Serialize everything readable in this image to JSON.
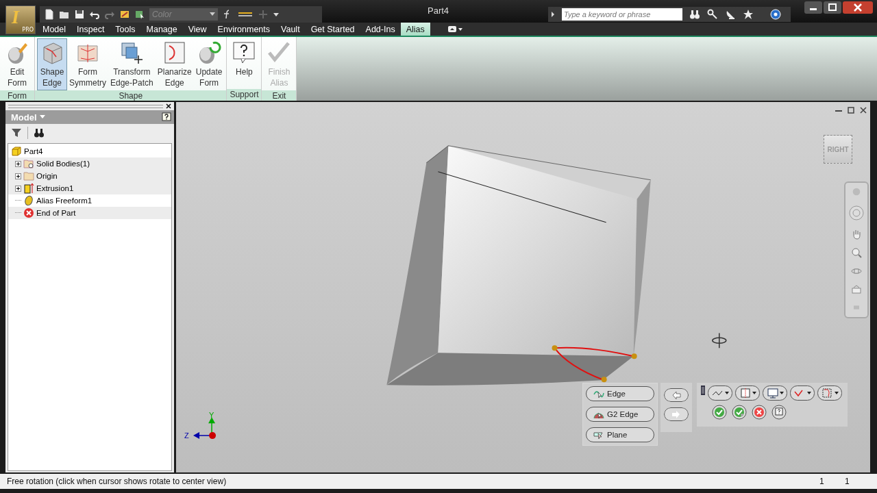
{
  "title_bar": {
    "app_logo": "I",
    "app_badge": "PRO",
    "color_field": {
      "placeholder": "Color"
    },
    "title": "Part4",
    "search": {
      "placeholder": "Type a keyword or phrase"
    }
  },
  "tabs": [
    {
      "label": "Model",
      "selected": false
    },
    {
      "label": "Inspect",
      "selected": false
    },
    {
      "label": "Tools",
      "selected": false
    },
    {
      "label": "Manage",
      "selected": false
    },
    {
      "label": "View",
      "selected": false
    },
    {
      "label": "Environments",
      "selected": false
    },
    {
      "label": "Vault",
      "selected": false
    },
    {
      "label": "Get Started",
      "selected": false
    },
    {
      "label": "Add-Ins",
      "selected": false
    },
    {
      "label": "Alias",
      "selected": true
    }
  ],
  "ribbon": {
    "groups": [
      {
        "label": "Form",
        "buttons": [
          {
            "kind": "edit",
            "lines": [
              "Edit",
              "Form"
            ],
            "selected": false,
            "disabled": false
          }
        ]
      },
      {
        "label": "Shape",
        "buttons": [
          {
            "kind": "shape",
            "lines": [
              "Shape",
              "Edge"
            ],
            "selected": true,
            "disabled": false
          },
          {
            "kind": "symmetry",
            "lines": [
              "Form",
              "Symmetry"
            ],
            "selected": false,
            "disabled": false
          },
          {
            "kind": "transform",
            "lines": [
              "Transform",
              "Edge-Patch"
            ],
            "selected": false,
            "disabled": false
          },
          {
            "kind": "planarize",
            "lines": [
              "Planarize",
              "Edge"
            ],
            "selected": false,
            "disabled": false
          },
          {
            "kind": "update",
            "lines": [
              "Update",
              "Form"
            ],
            "selected": false,
            "disabled": false
          }
        ]
      },
      {
        "label": "Support",
        "buttons": [
          {
            "kind": "help",
            "lines": [
              "Help"
            ],
            "selected": false,
            "disabled": false
          }
        ]
      },
      {
        "label": "Exit",
        "buttons": [
          {
            "kind": "finish",
            "lines": [
              "Finish",
              "Alias"
            ],
            "selected": false,
            "disabled": true
          }
        ]
      }
    ]
  },
  "browser": {
    "title": "Model",
    "tree": [
      {
        "label": "Part4",
        "kind": "part",
        "children": [
          {
            "label": "Solid Bodies(1)",
            "kind": "bodies",
            "expandable": true
          },
          {
            "label": "Origin",
            "kind": "folder",
            "expandable": true
          },
          {
            "label": "Extrusion1",
            "kind": "extrusion",
            "expandable": true
          },
          {
            "label": "Alias Freeform1",
            "kind": "freeform",
            "expandable": false
          },
          {
            "label": "End of Part",
            "kind": "end",
            "expandable": false
          }
        ]
      }
    ]
  },
  "viewcube": {
    "label": "RIGHT"
  },
  "mini_toolbar": {
    "buttons": [
      {
        "label": "Edge",
        "kind": "edge"
      },
      {
        "label": "G2 Edge",
        "kind": "g2"
      },
      {
        "label": "Plane",
        "kind": "plane"
      }
    ]
  },
  "axis": {
    "y": "Y",
    "z": "Z"
  },
  "status_bar": {
    "message": "Free rotation (click when cursor shows rotate to center view)",
    "fields": [
      "1",
      "1"
    ]
  }
}
